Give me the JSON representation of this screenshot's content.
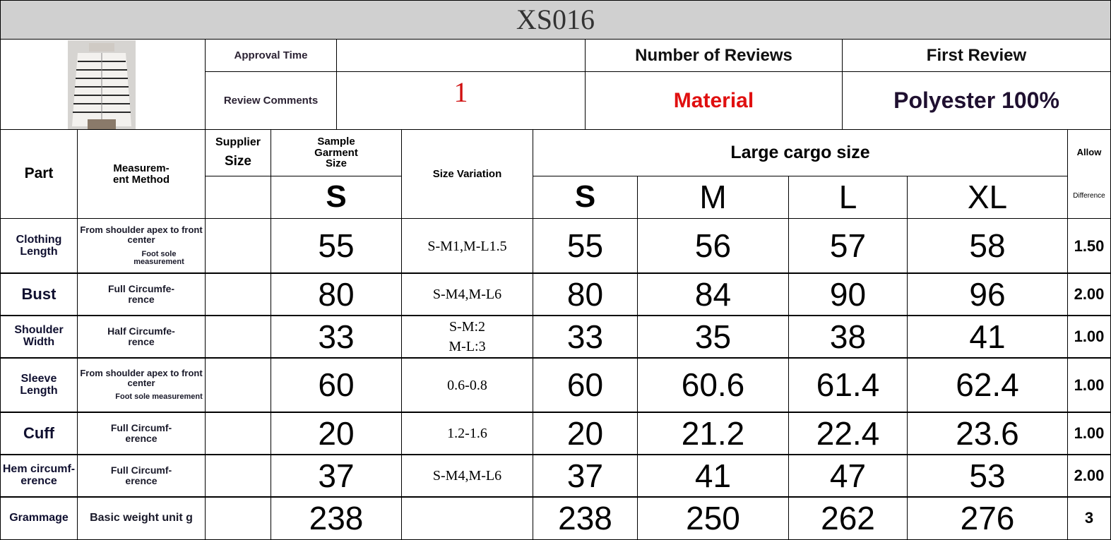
{
  "title": "XS016",
  "info": {
    "approval_time_label": "Approval Time",
    "approval_time_value": "",
    "review_comments_label": "Review Comments",
    "review_comments_value": "1",
    "number_of_reviews_label": "Number of Reviews",
    "first_review_label": "First Review",
    "material_label": "Material",
    "material_value": "Polyester 100%"
  },
  "headers": {
    "part": "Part",
    "method": "Measurem-\nent Method",
    "supplier": "Supplier",
    "supplier_size": "Size",
    "sample": "Sample\nGarment\nSize",
    "sample_size": "S",
    "variation": "Size Variation",
    "large": "Large cargo size",
    "sizes": [
      "S",
      "M",
      "L",
      "XL"
    ],
    "allow": "Allow",
    "difference": "Difference"
  },
  "rows": [
    {
      "part": "Clothing\nLength",
      "method1": "From shoulder apex to front\ncenter",
      "method2": "Foot sole\nmeasurement",
      "supplier": "",
      "sample": "55",
      "variation": "S-M1,M-L1.5",
      "s": "55",
      "m": "56",
      "l": "57",
      "xl": "58",
      "allow": "1.50"
    },
    {
      "part": "Bust",
      "method1": "Full Circumfe-\nrence",
      "method2": "",
      "supplier": "",
      "sample": "80",
      "variation": "S-M4,M-L6",
      "s": "80",
      "m": "84",
      "l": "90",
      "xl": "96",
      "allow": "2.00"
    },
    {
      "part": "Shoulder\nWidth",
      "method1": "Half Circumfe-\nrence",
      "method2": "",
      "supplier": "",
      "sample": "33",
      "variation": "S-M:2\nM-L:3",
      "s": "33",
      "m": "35",
      "l": "38",
      "xl": "41",
      "allow": "1.00"
    },
    {
      "part": "Sleeve\nLength",
      "method1": "From shoulder apex to front\ncenter",
      "method2": "Foot sole measurement",
      "supplier": "",
      "sample": "60",
      "variation": "0.6-0.8",
      "s": "60",
      "m": "60.6",
      "l": "61.4",
      "xl": "62.4",
      "allow": "1.00"
    },
    {
      "part": "Cuff",
      "method1": "Full Circumf-\nerence",
      "method2": "",
      "supplier": "",
      "sample": "20",
      "variation": "1.2-1.6",
      "s": "20",
      "m": "21.2",
      "l": "22.4",
      "xl": "23.6",
      "allow": "1.00"
    },
    {
      "part": "Hem circumf-\nerence",
      "method1": "Full Circumf-\nerence",
      "method2": "",
      "supplier": "",
      "sample": "37",
      "variation": "S-M4,M-L6",
      "s": "37",
      "m": "41",
      "l": "47",
      "xl": "53",
      "allow": "2.00"
    },
    {
      "part": "Grammage",
      "method1": "Basic weight unit g",
      "method2": "",
      "supplier": "",
      "sample": "238",
      "variation": "",
      "s": "238",
      "m": "250",
      "l": "262",
      "xl": "276",
      "allow": "3"
    }
  ]
}
